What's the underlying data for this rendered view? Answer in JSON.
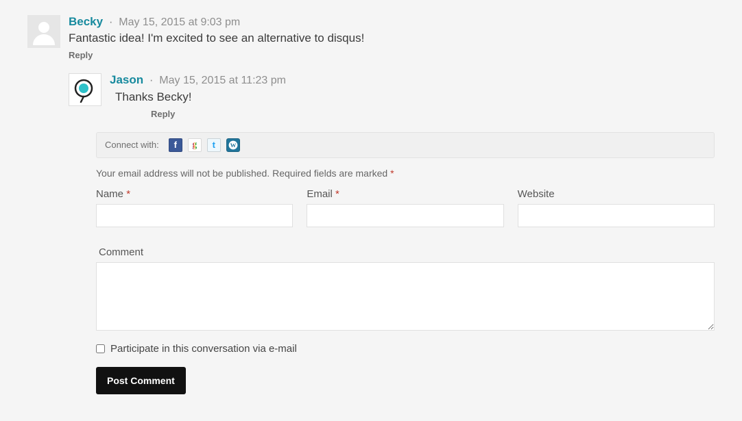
{
  "comments": [
    {
      "author": "Becky",
      "date": "May 15, 2015 at 9:03 pm",
      "body": "Fantastic idea! I'm excited to see an alternative to disqus!",
      "reply": "Reply",
      "sep": "·"
    },
    {
      "author": "Jason",
      "date": "May 15, 2015 at 11:23 pm",
      "body": "Thanks Becky!",
      "reply": "Reply",
      "sep": "·"
    }
  ],
  "connect": {
    "label": "Connect with:"
  },
  "note": {
    "text1": "Your email address will not be published.",
    "text2": "Required fields are marked",
    "req": "*"
  },
  "fields": {
    "name": {
      "label": "Name",
      "req": "*"
    },
    "email": {
      "label": "Email",
      "req": "*"
    },
    "website": {
      "label": "Website"
    }
  },
  "commentBox": {
    "label": "Comment"
  },
  "participate": {
    "label": "Participate in this conversation via e-mail"
  },
  "submit": {
    "label": "Post Comment"
  }
}
